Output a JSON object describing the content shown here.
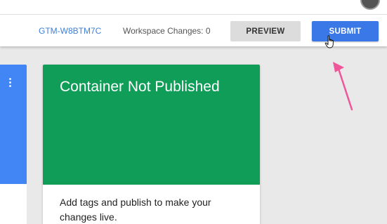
{
  "toolbar": {
    "container_id": "GTM-W8BTM7C",
    "workspace_changes": "Workspace Changes: 0",
    "preview_label": "PREVIEW",
    "submit_label": "SUBMIT"
  },
  "card": {
    "title": "Container Not Published",
    "body": "Add tags and publish to make your changes live."
  },
  "icons": {
    "more": "more-vert-icon",
    "cursor": "hand-cursor-icon",
    "annotation": "pink-arrow-icon"
  },
  "colors": {
    "submit": "#3b78e7",
    "card_header": "#0f9d58",
    "left_card": "#4285f4",
    "container_id": "#3f7fd6",
    "annotation_arrow": "#f0569a"
  }
}
